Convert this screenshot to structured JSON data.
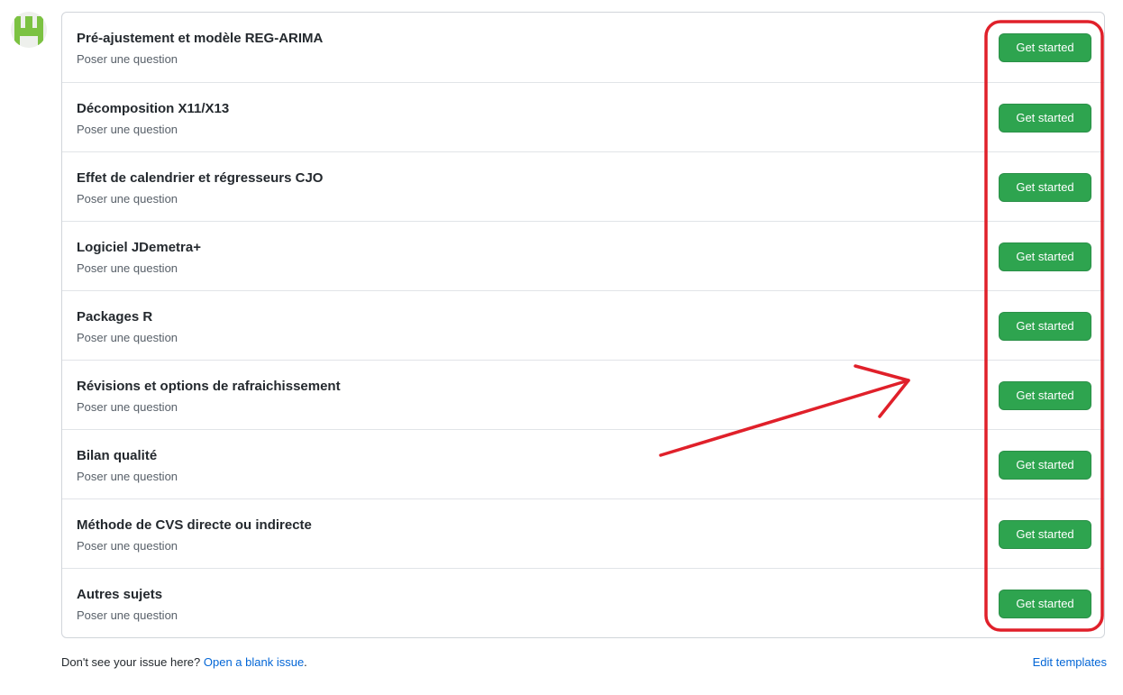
{
  "avatar": {
    "icon": "identicon-avatar-icon",
    "color": "#7cc242"
  },
  "templates": [
    {
      "title": "Pré-ajustement et modèle REG-ARIMA",
      "subtitle": "Poser une question",
      "button": "Get started"
    },
    {
      "title": "Décomposition X11/X13",
      "subtitle": "Poser une question",
      "button": "Get started"
    },
    {
      "title": "Effet de calendrier et régresseurs CJO",
      "subtitle": "Poser une question",
      "button": "Get started"
    },
    {
      "title": "Logiciel JDemetra+",
      "subtitle": "Poser une question",
      "button": "Get started"
    },
    {
      "title": "Packages R",
      "subtitle": "Poser une question",
      "button": "Get started"
    },
    {
      "title": "Révisions et options de rafraichissement",
      "subtitle": "Poser une question",
      "button": "Get started"
    },
    {
      "title": "Bilan qualité",
      "subtitle": "Poser une question",
      "button": "Get started"
    },
    {
      "title": "Méthode de CVS directe ou indirecte",
      "subtitle": "Poser une question",
      "button": "Get started"
    },
    {
      "title": "Autres sujets",
      "subtitle": "Poser une question",
      "button": "Get started"
    }
  ],
  "footer": {
    "prompt": "Don't see your issue here?",
    "blank_issue_link": "Open a blank issue",
    "period": ".",
    "edit_templates": "Edit templates"
  },
  "colors": {
    "button_green": "#2ea44f",
    "link_blue": "#0366d6",
    "annotation_red": "#e0202a"
  }
}
